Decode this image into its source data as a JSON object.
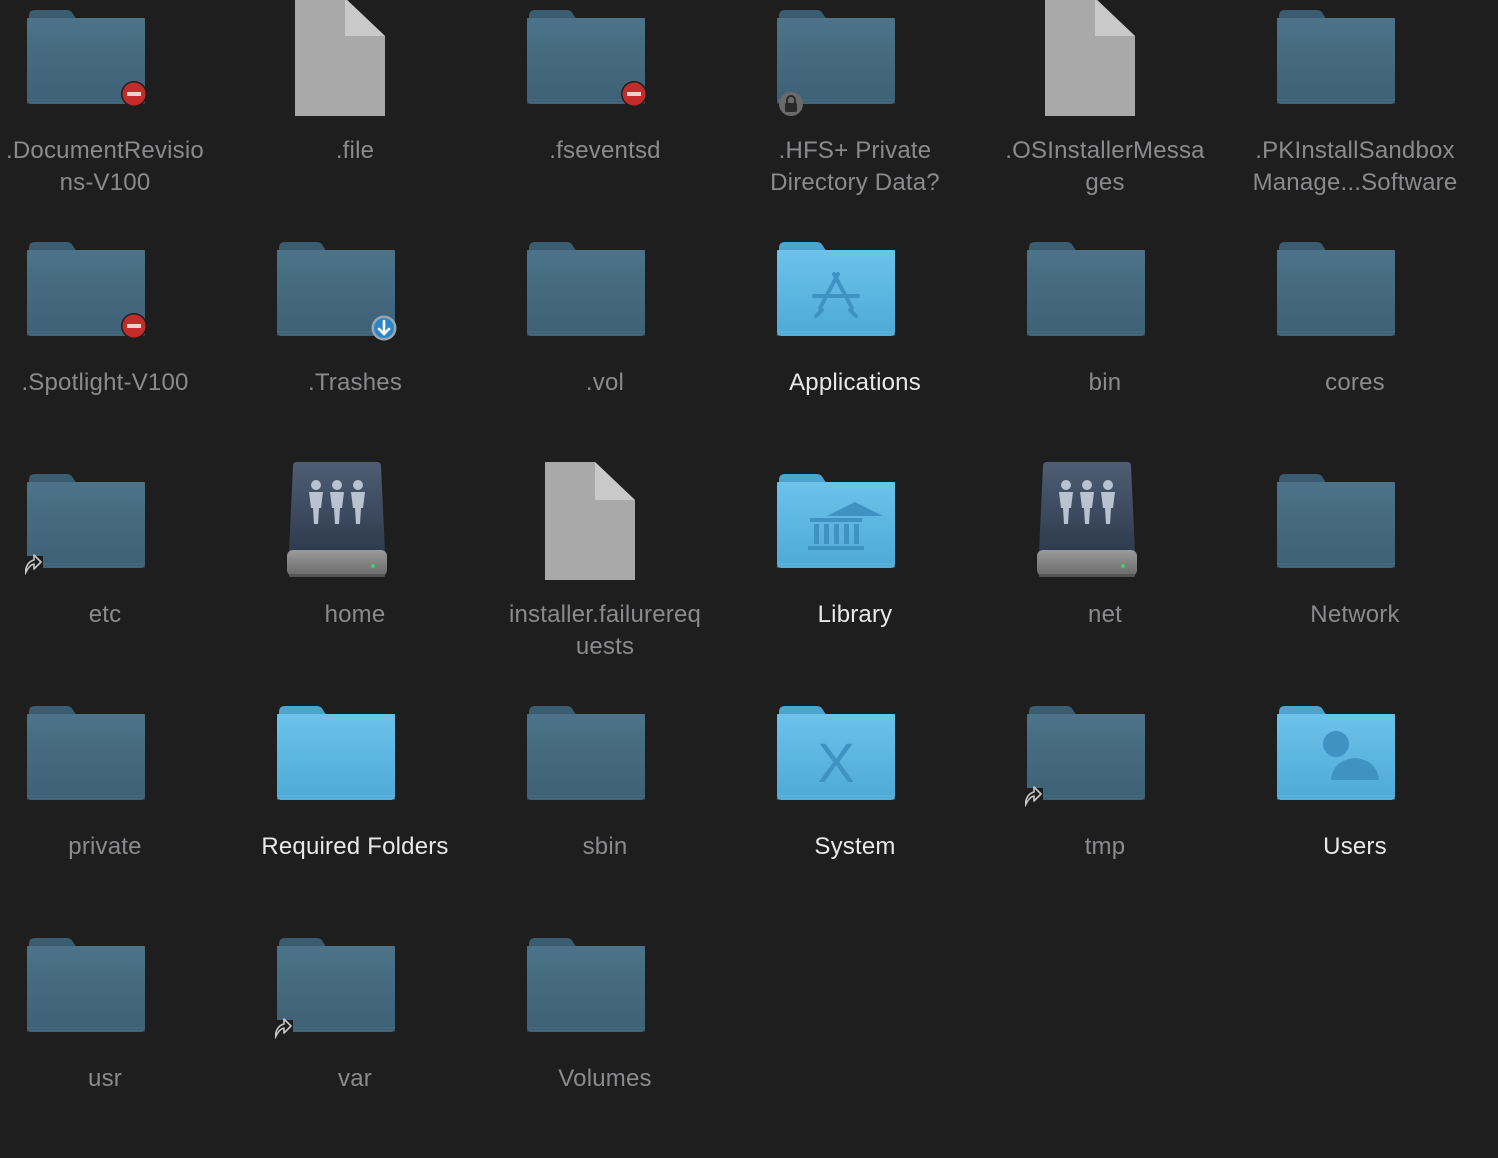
{
  "window": {
    "title": ""
  },
  "items": [
    {
      "name": ".DocumentRevisions-V100",
      "lines": [
        ".DocumentRevisio",
        "ns-V100"
      ],
      "icon": "folder-dark",
      "badge": "no-entry",
      "bright": false
    },
    {
      "name": ".file",
      "lines": [
        ".file"
      ],
      "icon": "document",
      "badge": "",
      "bright": false
    },
    {
      "name": ".fseventsd",
      "lines": [
        ".fseventsd"
      ],
      "icon": "folder-dark",
      "badge": "no-entry",
      "bright": false
    },
    {
      "name": ".HFS+ Private Directory Data?",
      "lines": [
        ".HFS+ Private",
        "Directory Data?"
      ],
      "icon": "folder-dark",
      "badge": "lock",
      "bright": false
    },
    {
      "name": ".OSInstallerMessages",
      "lines": [
        ".OSInstallerMessa",
        "ges"
      ],
      "icon": "document",
      "badge": "",
      "bright": false
    },
    {
      "name": ".PKInstallSandboxManager-SystemSoftware",
      "lines": [
        ".PKInstallSandbox",
        "Manage...Software"
      ],
      "icon": "folder-dark",
      "badge": "",
      "bright": false
    },
    {
      "name": ".Spotlight-V100",
      "lines": [
        ".Spotlight-V100"
      ],
      "icon": "folder-dark",
      "badge": "no-entry",
      "bright": false
    },
    {
      "name": ".Trashes",
      "lines": [
        ".Trashes"
      ],
      "icon": "folder-dark",
      "badge": "drop-box",
      "bright": false
    },
    {
      "name": ".vol",
      "lines": [
        ".vol"
      ],
      "icon": "folder-dark",
      "badge": "",
      "bright": false
    },
    {
      "name": "Applications",
      "lines": [
        "Applications"
      ],
      "icon": "folder-applications",
      "badge": "",
      "bright": true
    },
    {
      "name": "bin",
      "lines": [
        "bin"
      ],
      "icon": "folder-dark",
      "badge": "",
      "bright": false
    },
    {
      "name": "cores",
      "lines": [
        "cores"
      ],
      "icon": "folder-dark",
      "badge": "",
      "bright": false
    },
    {
      "name": "etc",
      "lines": [
        "etc"
      ],
      "icon": "folder-dark",
      "badge": "alias",
      "bright": false
    },
    {
      "name": "home",
      "lines": [
        "home"
      ],
      "icon": "network-server",
      "badge": "",
      "bright": false
    },
    {
      "name": "installer.failurerequests",
      "lines": [
        "installer.failurereq",
        "uests"
      ],
      "icon": "document",
      "badge": "",
      "bright": false
    },
    {
      "name": "Library",
      "lines": [
        "Library"
      ],
      "icon": "folder-library",
      "badge": "",
      "bright": true
    },
    {
      "name": "net",
      "lines": [
        "net"
      ],
      "icon": "network-server",
      "badge": "",
      "bright": false
    },
    {
      "name": "Network",
      "lines": [
        "Network"
      ],
      "icon": "folder-dark",
      "badge": "",
      "bright": false
    },
    {
      "name": "private",
      "lines": [
        "private"
      ],
      "icon": "folder-dark",
      "badge": "",
      "bright": false
    },
    {
      "name": "Required Folders",
      "lines": [
        "Required Folders"
      ],
      "icon": "folder-blue",
      "badge": "",
      "bright": true
    },
    {
      "name": "sbin",
      "lines": [
        "sbin"
      ],
      "icon": "folder-dark",
      "badge": "",
      "bright": false
    },
    {
      "name": "System",
      "lines": [
        "System"
      ],
      "icon": "folder-system",
      "badge": "",
      "bright": true
    },
    {
      "name": "tmp",
      "lines": [
        "tmp"
      ],
      "icon": "folder-dark",
      "badge": "alias",
      "bright": false
    },
    {
      "name": "Users",
      "lines": [
        "Users"
      ],
      "icon": "folder-users",
      "badge": "",
      "bright": true
    },
    {
      "name": "usr",
      "lines": [
        "usr"
      ],
      "icon": "folder-dark",
      "badge": "",
      "bright": false
    },
    {
      "name": "var",
      "lines": [
        "var"
      ],
      "icon": "folder-dark",
      "badge": "alias",
      "bright": false
    },
    {
      "name": "Volumes",
      "lines": [
        "Volumes"
      ],
      "icon": "folder-dark",
      "badge": "",
      "bright": false
    }
  ],
  "colors": {
    "background": "#1e1e1f",
    "folder_dark": "#44697f",
    "folder_blue": "#5bb3dd",
    "label_dim": "#8b8b8d",
    "label_bright": "#e8e8e9",
    "badge_red": "#c42b2b",
    "badge_blue": "#2b86c8",
    "document": "#a9a9a9"
  }
}
